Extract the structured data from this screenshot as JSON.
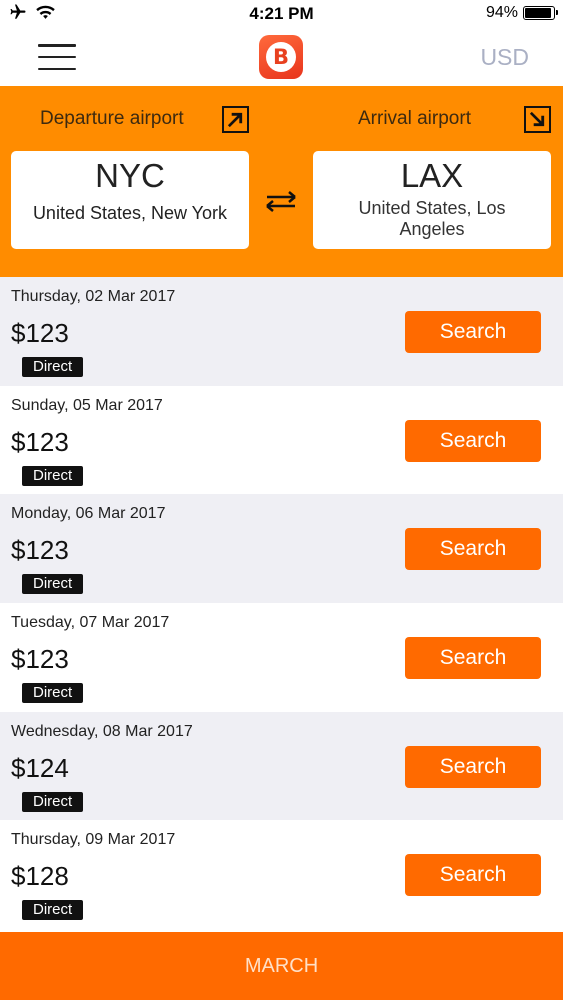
{
  "status_bar": {
    "time": "4:21 PM",
    "battery_percent": "94%",
    "battery_level": 0.94,
    "icons": [
      "airplane-icon",
      "wifi-icon",
      "battery-icon"
    ]
  },
  "nav": {
    "currency": "USD",
    "logo_letter": "B"
  },
  "route": {
    "departure_label": "Departure airport",
    "arrival_label": "Arrival airport",
    "departure": {
      "code": "NYC",
      "city": "United States, New York"
    },
    "arrival": {
      "code": "LAX",
      "city": "United States, Los Angeles"
    }
  },
  "flights": [
    {
      "date": "Thursday, 02 Mar 2017",
      "price": "$123",
      "tag": "Direct",
      "button": "Search"
    },
    {
      "date": "Sunday, 05 Mar 2017",
      "price": "$123",
      "tag": "Direct",
      "button": "Search"
    },
    {
      "date": "Monday, 06 Mar 2017",
      "price": "$123",
      "tag": "Direct",
      "button": "Search"
    },
    {
      "date": "Tuesday, 07 Mar 2017",
      "price": "$123",
      "tag": "Direct",
      "button": "Search"
    },
    {
      "date": "Wednesday, 08 Mar 2017",
      "price": "$124",
      "tag": "Direct",
      "button": "Search"
    },
    {
      "date": "Thursday, 09 Mar 2017",
      "price": "$128",
      "tag": "Direct",
      "button": "Search"
    }
  ],
  "bottom": {
    "month_label": "MARCH"
  },
  "colors": {
    "header_orange": "#ff8c00",
    "button_orange": "#ff6a00",
    "currency_grey": "#aab0c4",
    "row_alt": "#efeff4"
  }
}
